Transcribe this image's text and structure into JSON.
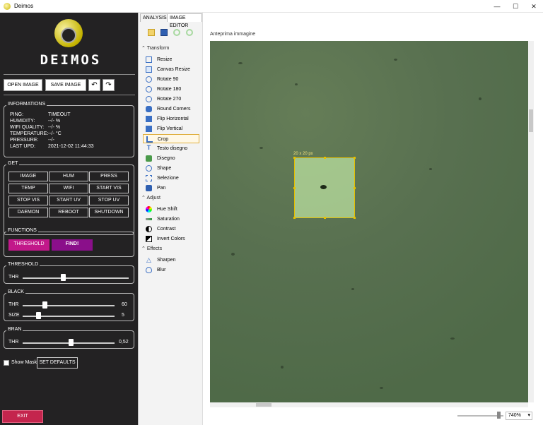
{
  "window": {
    "title": "Deimos",
    "minimize": "—",
    "maximize": "☐",
    "close": "✕"
  },
  "logo": {
    "text": "DEIMOS"
  },
  "toolbar": {
    "open_image": "OPEN IMAGE",
    "save_image": "SAVE IMAGE",
    "undo": "↶",
    "redo": "↷"
  },
  "informations": {
    "title": "INFORMATIONS",
    "rows": [
      {
        "label": "PING:",
        "value": "TIMEOUT"
      },
      {
        "label": "HUMIDITY:",
        "value": "--/- %"
      },
      {
        "label": "WIFI QUALITY:",
        "value": "--/- %"
      },
      {
        "label": "TEMPERATURE:",
        "value": "--/- °C"
      },
      {
        "label": "PRESSURE:",
        "value": "--/-"
      },
      {
        "label": "LAST UPD:",
        "value": "2021-12-02 11:44:33"
      }
    ]
  },
  "get": {
    "title": "GET",
    "buttons": [
      "IMAGE",
      "HUM",
      "PRESS",
      "TEMP",
      "WIFI",
      "START VIS",
      "STOP VIS",
      "START UV",
      "STOP UV",
      "DAEMON",
      "REBOOT",
      "SHUTDOWN"
    ]
  },
  "functions": {
    "title": "FUNCTIONS",
    "threshold": "THRESHOLD",
    "find": "FIND!",
    "threshold_color": "#c2188a",
    "find_color": "#8a0f8a"
  },
  "threshold": {
    "title": "THRESHOLD",
    "thr_label": "THR",
    "thr_level": 0.38
  },
  "black": {
    "title": "BLACK",
    "thr_label": "THR",
    "thr_value": "60",
    "thr_level": 0.2,
    "size_label": "SIZE",
    "size_value": "5",
    "size_level": 0.15
  },
  "bran": {
    "title": "BRAN",
    "thr_label": "THR",
    "thr_value": "0,52",
    "thr_level": 0.5
  },
  "show_mask": "Show Mask",
  "set_defaults": "SET DEFAULTS",
  "exit": "EXIT",
  "tabs": {
    "analysis": "ANALYSIS",
    "image_editor": "IMAGE EDITOR"
  },
  "editor": {
    "transform_title": "Transform",
    "transform_items": [
      {
        "label": "Resize",
        "icon": "resize-icon"
      },
      {
        "label": "Canvas Resize",
        "icon": "canvas-resize-icon"
      },
      {
        "label": "Rotate 90",
        "icon": "rotate-icon"
      },
      {
        "label": "Rotate 180",
        "icon": "rotate-icon"
      },
      {
        "label": "Rotate 270",
        "icon": "rotate-icon"
      },
      {
        "label": "Round Corners",
        "icon": "round-corners-icon"
      },
      {
        "label": "Flip Horizontal",
        "icon": "flip-horizontal-icon"
      },
      {
        "label": "Flip Vertical",
        "icon": "flip-vertical-icon"
      },
      {
        "label": "Crop",
        "icon": "crop-icon"
      },
      {
        "label": "Testo disegno",
        "icon": "text-icon"
      },
      {
        "label": "Disegno",
        "icon": "draw-icon"
      },
      {
        "label": "Shape",
        "icon": "shape-icon"
      },
      {
        "label": "Selezione",
        "icon": "selection-icon"
      },
      {
        "label": "Pan",
        "icon": "pan-icon"
      }
    ],
    "adjust_title": "Adjust",
    "adjust_items": [
      {
        "label": "Hue Shift",
        "icon": "hue-icon"
      },
      {
        "label": "Saturation",
        "icon": "saturation-icon"
      },
      {
        "label": "Contrast",
        "icon": "contrast-icon"
      },
      {
        "label": "Invert Colors",
        "icon": "invert-icon"
      }
    ],
    "effects_title": "Effects",
    "effects_items": [
      {
        "label": "Sharpen",
        "icon": "sharpen-icon"
      },
      {
        "label": "Blur",
        "icon": "blur-icon"
      }
    ]
  },
  "preview": {
    "label": "Anteprima immagine",
    "crop_label": "20 x 20 px",
    "zoom": "740%"
  }
}
